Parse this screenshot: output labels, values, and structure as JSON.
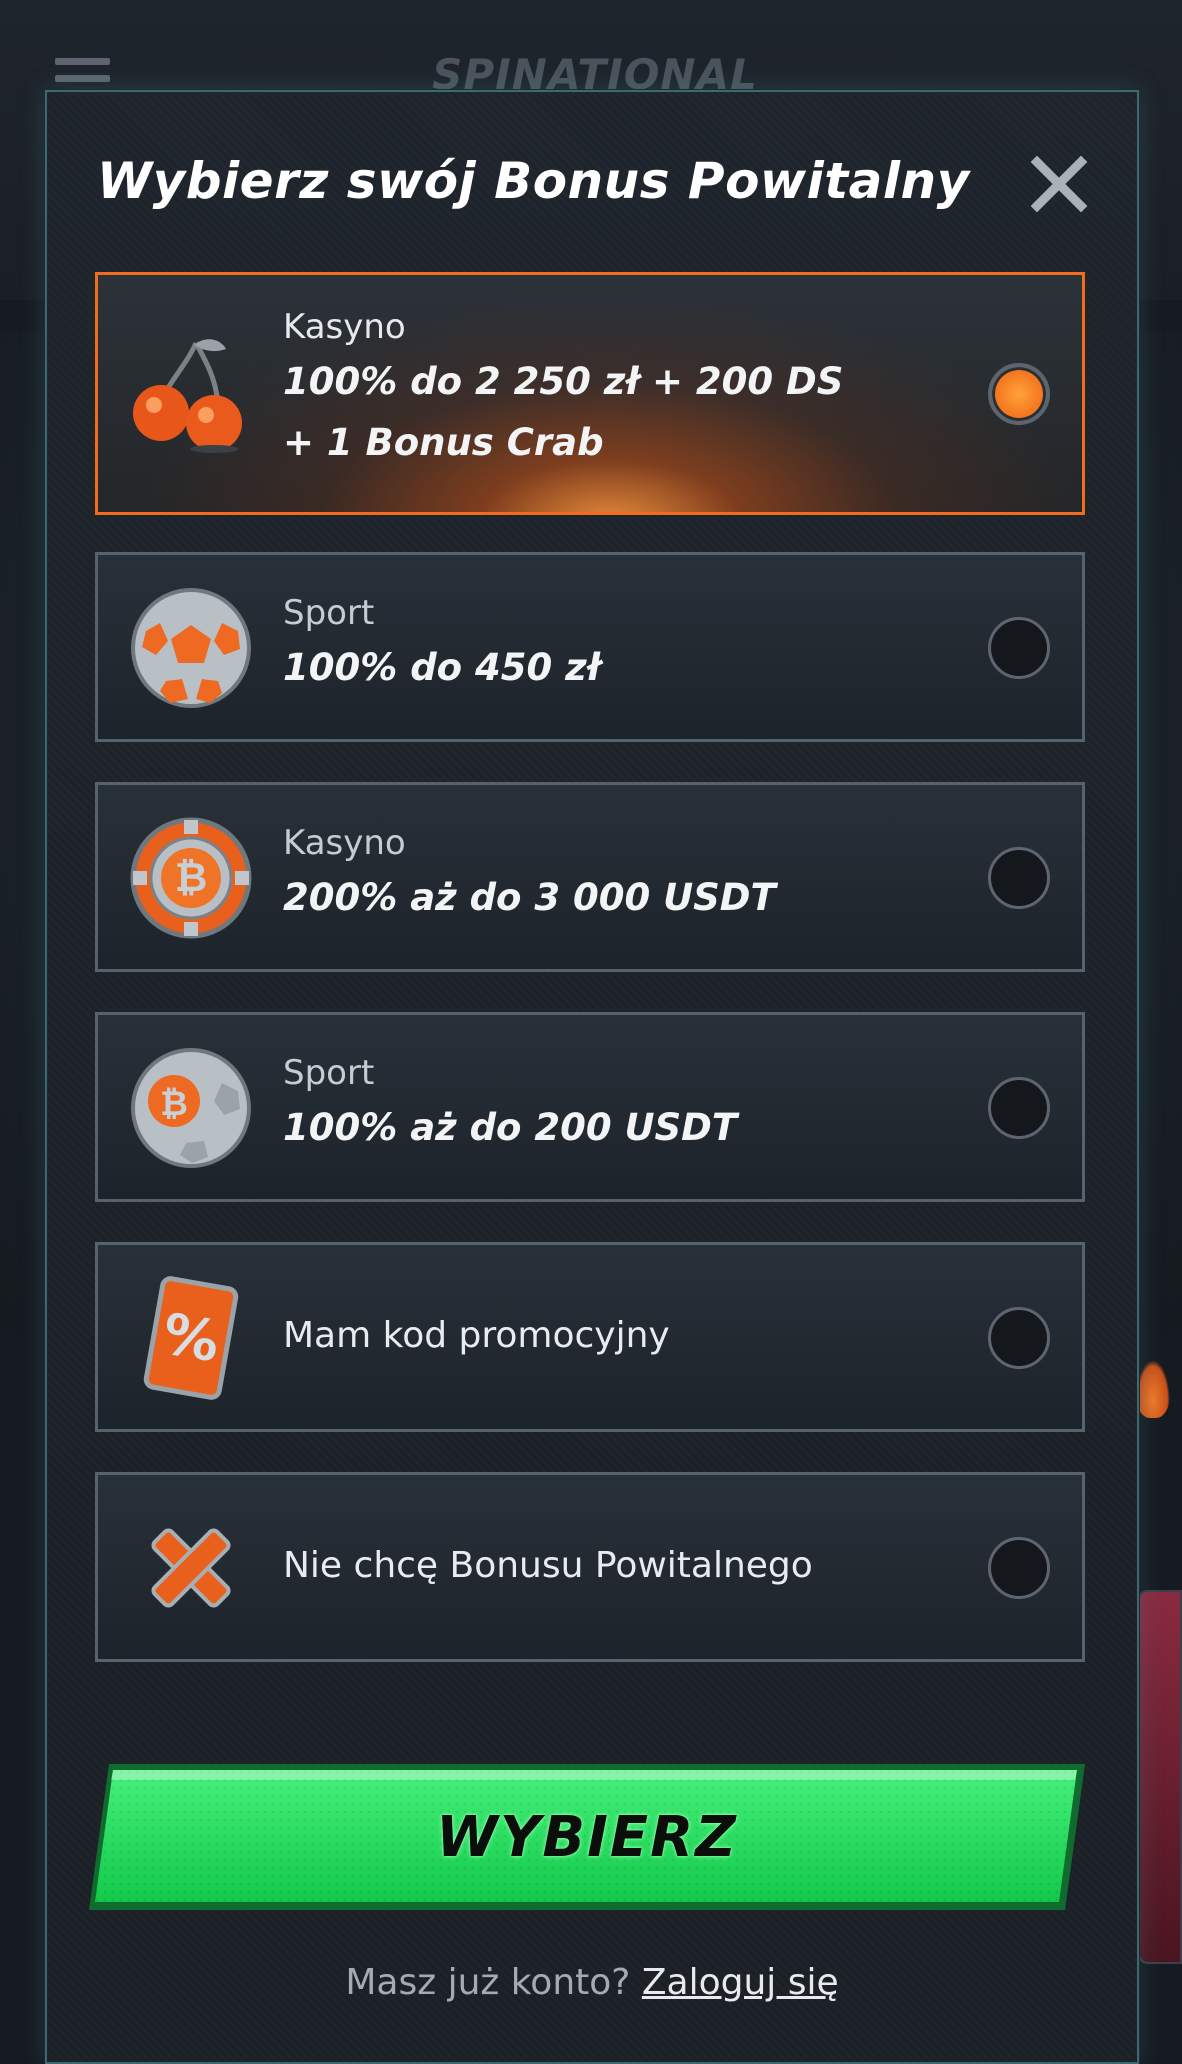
{
  "header": {
    "logo_text": "SPINATIONAL"
  },
  "modal": {
    "title": "Wybierz swój Bonus Powitalny",
    "close_icon": "close-icon",
    "options": [
      {
        "category": "Kasyno",
        "value_line1": "100% do 2 250 zł + 200 DS",
        "value_line2": "+ 1 Bonus Crab",
        "icon": "cherries-icon",
        "selected": true
      },
      {
        "category": "Sport",
        "value_line1": "100% do 450 zł",
        "icon": "soccer-ball-icon",
        "selected": false
      },
      {
        "category": "Kasyno",
        "value_line1": "200% aż do 3 000 USDT",
        "icon": "bitcoin-chip-icon",
        "selected": false
      },
      {
        "category": "Sport",
        "value_line1": "100% aż do 200 USDT",
        "icon": "bitcoin-soccer-ball-icon",
        "selected": false
      },
      {
        "label": "Mam kod promocyjny",
        "icon": "percent-card-icon",
        "selected": false
      },
      {
        "label": "Nie chcę Bonusu Powitalnego",
        "icon": "cross-icon",
        "selected": false
      }
    ],
    "cta_label": "WYBIERZ",
    "footer_prompt": "Masz już konto?",
    "footer_link": "Zaloguj się"
  },
  "colors": {
    "accent_orange": "#f36b1c",
    "cta_green": "#1fe05a",
    "modal_border": "#3c6a70"
  }
}
